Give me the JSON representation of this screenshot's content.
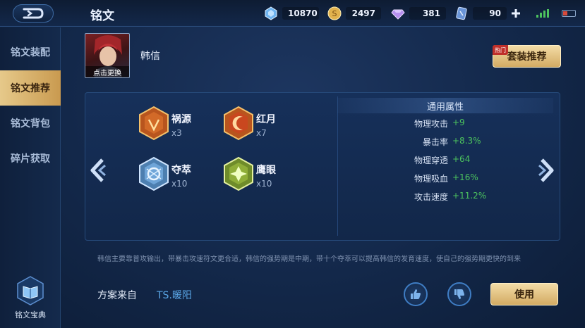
{
  "header": {
    "title": "铭文",
    "currencies": [
      {
        "icon": "diamond-icon",
        "value": "10870"
      },
      {
        "icon": "gold-coin-icon",
        "value": "2497"
      },
      {
        "icon": "gem-icon",
        "value": "381"
      },
      {
        "icon": "coupon-icon",
        "value": "90"
      }
    ]
  },
  "sidebar": {
    "items": [
      {
        "label": "铭文装配",
        "active": false
      },
      {
        "label": "铭文推荐",
        "active": true
      },
      {
        "label": "铭文背包",
        "active": false
      },
      {
        "label": "碎片获取",
        "active": false
      }
    ],
    "codex_label": "铭文宝典"
  },
  "hero": {
    "swap_label": "点击更换",
    "name": "韩信"
  },
  "recommend": {
    "hot_badge": "热门",
    "label": "套装推荐"
  },
  "runes": [
    {
      "name": "祸源",
      "count": "x3",
      "color": "red"
    },
    {
      "name": "红月",
      "count": "x7",
      "color": "red"
    },
    {
      "name": "夺萃",
      "count": "x10",
      "color": "blue"
    },
    {
      "name": "鹰眼",
      "count": "x10",
      "color": "green"
    }
  ],
  "attributes": {
    "title": "通用属性",
    "rows": [
      {
        "label": "物理攻击",
        "value": "+9"
      },
      {
        "label": "暴击率",
        "value": "+8.3%"
      },
      {
        "label": "物理穿透",
        "value": "+64"
      },
      {
        "label": "物理吸血",
        "value": "+16%"
      },
      {
        "label": "攻击速度",
        "value": "+11.2%"
      }
    ]
  },
  "description": "韩信主要靠普攻输出，带暴击攻速符文更合适，韩信的强势期是中期，带十个夺萃可以提高韩信的发育速度，使自己的强势期更快的到来",
  "plan": {
    "label": "方案来自",
    "author": "TS.暖阳"
  },
  "use_label": "使用",
  "colors": {
    "accent_gold": "#d3ab63",
    "value_green": "#4cc35e",
    "author_blue": "#5aa6e6"
  }
}
